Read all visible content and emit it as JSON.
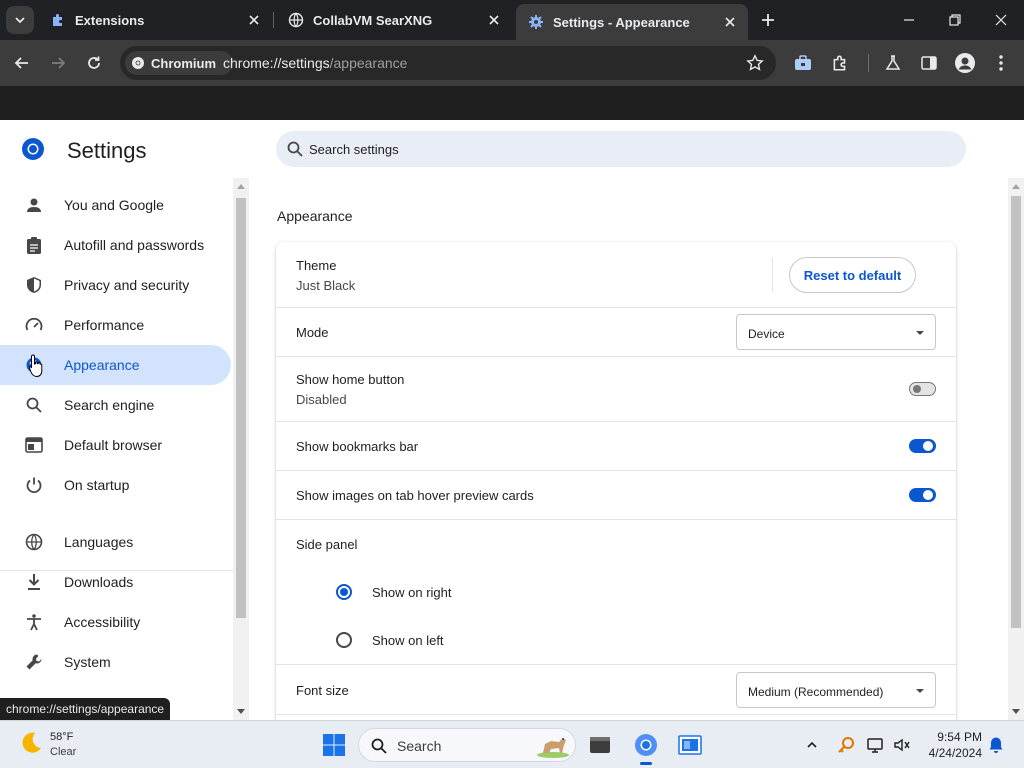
{
  "browser": {
    "tabs": [
      {
        "title": "Extensions",
        "icon": "puzzle-icon",
        "active": false
      },
      {
        "title": "CollabVM SearXNG",
        "icon": "globe-icon",
        "active": false
      },
      {
        "title": "Settings - Appearance",
        "icon": "gear-icon",
        "active": true
      }
    ],
    "security_chip": "Chromium",
    "url_host": "chrome://settings",
    "url_path": "/appearance",
    "status_tooltip": "chrome://settings/appearance"
  },
  "settings": {
    "title": "Settings",
    "search_placeholder": "Search settings",
    "nav": [
      {
        "label": "You and Google",
        "icon": "person-icon"
      },
      {
        "label": "Autofill and passwords",
        "icon": "clipboard-icon"
      },
      {
        "label": "Privacy and security",
        "icon": "shield-icon"
      },
      {
        "label": "Performance",
        "icon": "speedometer-icon"
      },
      {
        "label": "Appearance",
        "icon": "palette-icon",
        "selected": true
      },
      {
        "label": "Search engine",
        "icon": "search-icon"
      },
      {
        "label": "Default browser",
        "icon": "browser-window-icon"
      },
      {
        "label": "On startup",
        "icon": "power-icon"
      },
      {
        "label": "Languages",
        "icon": "globe-icon"
      },
      {
        "label": "Downloads",
        "icon": "download-icon"
      },
      {
        "label": "Accessibility",
        "icon": "accessibility-icon"
      },
      {
        "label": "System",
        "icon": "wrench-icon"
      }
    ],
    "section_title": "Appearance",
    "theme": {
      "label": "Theme",
      "value": "Just Black",
      "reset_label": "Reset to default"
    },
    "mode": {
      "label": "Mode",
      "value": "Device"
    },
    "home_button": {
      "label": "Show home button",
      "status": "Disabled",
      "enabled": false
    },
    "bookmarks_bar": {
      "label": "Show bookmarks bar",
      "enabled": true
    },
    "tab_hover": {
      "label": "Show images on tab hover preview cards",
      "enabled": true
    },
    "side_panel": {
      "label": "Side panel",
      "options": [
        {
          "label": "Show on right",
          "checked": true
        },
        {
          "label": "Show on left",
          "checked": false
        }
      ]
    },
    "font_size": {
      "label": "Font size",
      "value": "Medium (Recommended)"
    }
  },
  "taskbar": {
    "temperature": "58°F",
    "condition": "Clear",
    "search_label": "Search",
    "time": "9:54 PM",
    "date": "4/24/2024"
  },
  "colors": {
    "accent": "#0b57d0",
    "selected_nav_bg": "#d3e3fd",
    "browser_frame": "#202124"
  }
}
